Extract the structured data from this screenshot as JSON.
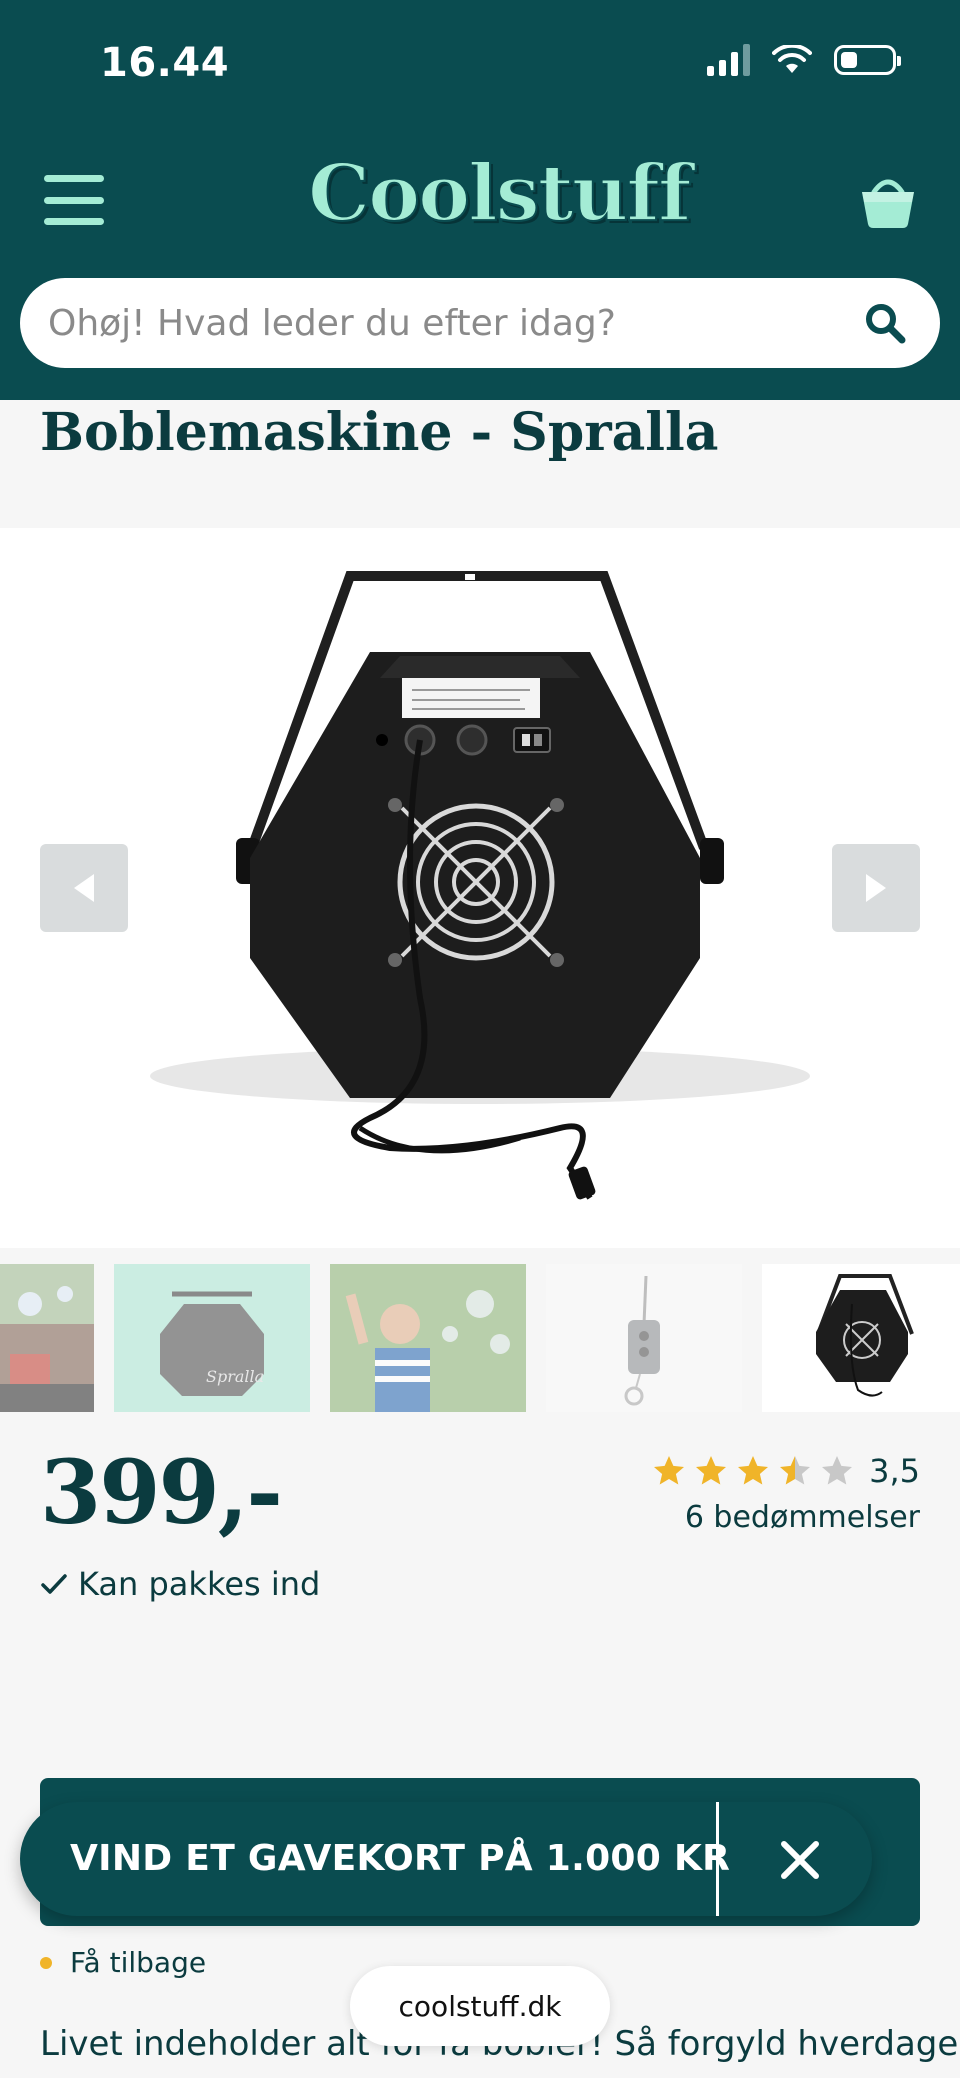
{
  "status_bar": {
    "time": "16.44"
  },
  "header": {
    "logo": "Coolstuff",
    "search": {
      "placeholder": "Ohøj! Hvad leder du efter idag?"
    },
    "icons": {
      "menu": "hamburger-icon",
      "cart": "basket-icon",
      "search": "search-icon"
    }
  },
  "product": {
    "title": "Boblemaskine - Spralla",
    "price": "399,-",
    "rating": {
      "value": 3.5,
      "display": "3,5",
      "max": 5,
      "reviews_label": "6 bedømmelser"
    },
    "giftwrap_label": "Kan pakkes ind",
    "thumbnails": [
      {
        "name": "bubbles-scene",
        "active": false
      },
      {
        "name": "machine-teal",
        "active": false
      },
      {
        "name": "child-bubbles",
        "active": false
      },
      {
        "name": "remote-control",
        "active": false
      },
      {
        "name": "machine-back",
        "active": true
      }
    ],
    "return_label": "Få tilbage",
    "description_start": "Livet indeholder alt for få bobler! Så forgyld hverdagen"
  },
  "banner": {
    "text": "VIND ET GAVEKORT PÅ 1.000 KR"
  },
  "browser": {
    "url": "coolstuff.dk"
  },
  "colors": {
    "brand": "#0a4c50",
    "accent": "#a4ecd5",
    "star": "#f0b429"
  }
}
